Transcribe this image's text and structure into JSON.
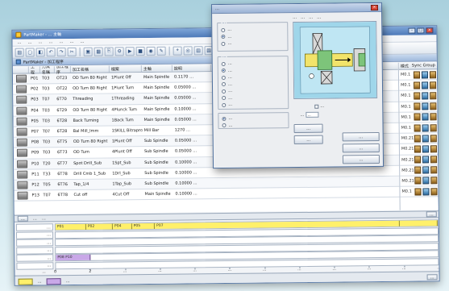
{
  "main_window": {
    "title": "PartMaker - … 主軸",
    "menu": [
      "…",
      "…",
      "…",
      "…",
      "…",
      "…",
      "…"
    ],
    "subwindow_title": "PartMaker - 加工程序",
    "table": {
      "columns": [
        "工程",
        "刀具名稱",
        "加工程序",
        "加工名稱",
        "檔案",
        "主軸",
        "說明"
      ],
      "rows": [
        {
          "no": "P01",
          "t": "T03",
          "cut": "OT23",
          "name": "OD Turn 80 Right",
          "file": "1Plunt Off",
          "spindle": "Main Spindle",
          "desc": "0.1170 …"
        },
        {
          "no": "P02",
          "t": "T03",
          "cut": "OT22",
          "name": "OD Turn 80 Right",
          "file": "1Plunt Turn",
          "spindle": "Main Spindle",
          "desc": "0.05000 …"
        },
        {
          "no": "P03",
          "t": "T07",
          "cut": "6T70",
          "name": "Threading",
          "file": "1Threading",
          "spindle": "Main Spindle",
          "desc": "0.05000 …"
        },
        {
          "no": "P04",
          "t": "T03",
          "cut": "6T29",
          "name": "OD Turn 80 Right",
          "file": "4Plunck Tum",
          "spindle": "Main Spindle",
          "desc": "0.10000 …"
        },
        {
          "no": "P05",
          "t": "T03",
          "cut": "6T28",
          "name": "Back Turning",
          "file": "1Back Tum",
          "spindle": "Main Spindle",
          "desc": "0.05000 …"
        },
        {
          "no": "P07",
          "t": "T07",
          "cut": "6T28",
          "name": "Bal Mill_Imm",
          "file": "1SKILL Bitrapro",
          "spindle": "Mill Bar",
          "desc": "1270 …"
        },
        {
          "no": "P08",
          "t": "T03",
          "cut": "6T75",
          "name": "OD Turn 80 Right",
          "file": "1Plunt Off",
          "spindle": "Sub Spindle",
          "desc": "0.05000 …"
        },
        {
          "no": "P09",
          "t": "T03",
          "cut": "6T73",
          "name": "OD Turn",
          "file": "4Plunt Off",
          "spindle": "Sub Spindle",
          "desc": "0.05000 …"
        },
        {
          "no": "P10",
          "t": "T20",
          "cut": "6T77",
          "name": "Spot Drill_Sub",
          "file": "1Spt_Sub",
          "spindle": "Sub Spindle",
          "desc": "0.10000 …"
        },
        {
          "no": "P11",
          "t": "T33",
          "cut": "6T78",
          "name": "Drill Cmb 1_Sub",
          "file": "1Drl_Sub",
          "spindle": "Sub Spindle",
          "desc": "0.10000 …"
        },
        {
          "no": "P12",
          "t": "T05",
          "cut": "6T76",
          "name": "Tap_1/4",
          "file": "1Tap_Sub",
          "spindle": "Sub Spindle",
          "desc": "0.10000 …"
        },
        {
          "no": "P13",
          "t": "T07",
          "cut": "6T78",
          "name": "Cut off",
          "file": "4Cut Off",
          "spindle": "Main Spindle",
          "desc": "0.10000 …"
        }
      ]
    },
    "right_panel": {
      "header": [
        "模式",
        "Sync Group"
      ],
      "rows": [
        "M0.1",
        "M0.1",
        "M0.1",
        "M0.1",
        "M0.1",
        "M0.1",
        "M0.21",
        "M0.21",
        "M0.21",
        "M0.21",
        "M0.21",
        "M0.1"
      ]
    },
    "status": {
      "left_btn": "…",
      "text1": "…",
      "text2": "…",
      "right_btn": "…"
    },
    "timeline": {
      "rows": [
        "…",
        "…",
        "…",
        "…",
        "…",
        "…"
      ],
      "segments": [
        {
          "label": "P01",
          "start": 0,
          "end": 8,
          "color": "yellow"
        },
        {
          "label": "P02",
          "start": 8,
          "end": 15,
          "color": "yellow"
        },
        {
          "label": "P04",
          "start": 15,
          "end": 20,
          "color": "yellow"
        },
        {
          "label": "P05",
          "start": 20,
          "end": 26,
          "color": "yellow"
        },
        {
          "label": "P07",
          "start": 26,
          "end": 90,
          "color": "yellow"
        },
        {
          "label": "",
          "start": 90,
          "end": 100,
          "color": "yellow"
        }
      ],
      "sub_segments": [
        {
          "label": "P08 P10",
          "start": 0,
          "end": 9,
          "color": "purple"
        }
      ],
      "ticks": [
        "0",
        "2",
        "…",
        "…",
        "…",
        "…",
        "…",
        "…",
        "…",
        "…",
        "…",
        "…"
      ],
      "axis_label": "…"
    },
    "bottom": {
      "chip1": "…",
      "chip2": "…",
      "right_btn": "…"
    }
  },
  "dialog": {
    "title": "…",
    "close": "×",
    "hint": [
      "…",
      "…",
      "…",
      "…"
    ],
    "group1": {
      "title": "…",
      "options": [
        {
          "label": "…",
          "on": false
        },
        {
          "label": "…",
          "on": true
        },
        {
          "label": "…",
          "on": false
        }
      ]
    },
    "group2": {
      "title": "…",
      "options": [
        {
          "label": "…",
          "on": false
        },
        {
          "label": "…",
          "on": true
        },
        {
          "label": "…",
          "on": false
        },
        {
          "label": "…",
          "on": false
        },
        {
          "label": "…",
          "on": false
        },
        {
          "label": "…",
          "on": false
        },
        {
          "label": "…",
          "on": false
        }
      ]
    },
    "group3": {
      "options": [
        {
          "label": "…",
          "on": true
        },
        {
          "label": "…",
          "on": false
        }
      ]
    },
    "checkbox_label": "…",
    "number_label": "…",
    "number_value": "…",
    "left_buttons": [
      "…",
      "…"
    ],
    "right_buttons": [
      "…",
      "…",
      "…"
    ]
  },
  "colors": {
    "accent": "#4d79b8",
    "timeline_yellow": "#fff06a",
    "timeline_purple": "#c9a8e8"
  }
}
